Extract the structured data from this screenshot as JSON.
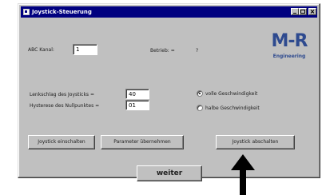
{
  "window": {
    "title": "Joystick-Steuerung",
    "minimize_label": "_",
    "maximize_label": "□",
    "close_label": "×"
  },
  "form": {
    "abc_label": "ABC Kanal:",
    "abc_value": "1",
    "betrieb_label": "Betrieb: =",
    "betrieb_value": "?",
    "lenk_label": "Lenkschlag des Joysticks =",
    "lenk_value": "40",
    "hysterese_label": "Hysterese des Nullpunktes =",
    "hysterese_value": "01",
    "radio_voll": "volle Geschwindigkeit",
    "radio_halb": "halbe Geschwindigkeit",
    "radio_selected": "voll"
  },
  "logo": {
    "main": "M-R",
    "sub": "Engineering",
    "color": "#2e4a8f"
  },
  "buttons": {
    "einschalten": "Joystick einschalten",
    "uebernehmen": "Parameter übernehmen",
    "abschalten": "Joystick abschalten",
    "weiter": "weiter"
  },
  "colors": {
    "titlebar": "#000080",
    "window_face": "#c0c0c0"
  }
}
